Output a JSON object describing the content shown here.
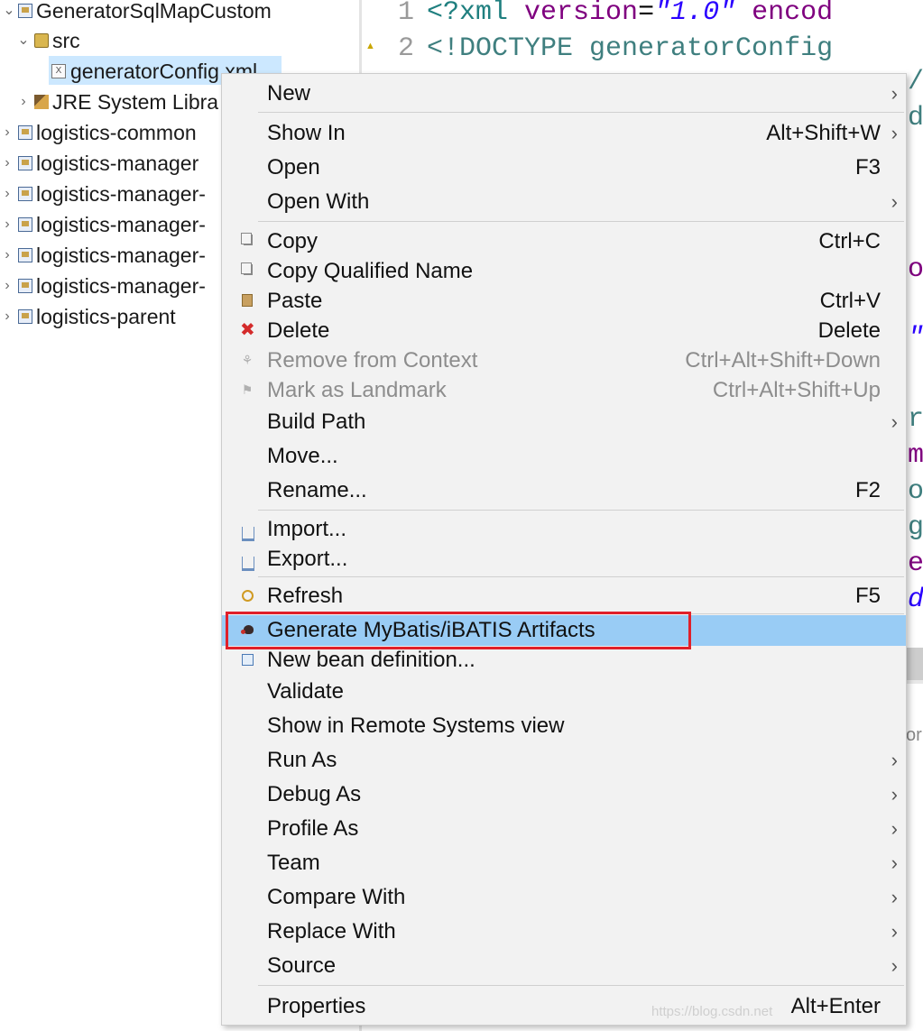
{
  "tree": {
    "items": [
      {
        "label": "GeneratorSqlMapCustom",
        "icon": "project-icon",
        "twisty": "expanded"
      },
      {
        "label": "src",
        "icon": "package-folder-icon",
        "twisty": "expanded"
      },
      {
        "label": "generatorConfig.xml",
        "icon": "xml-file-icon",
        "twisty": ""
      },
      {
        "label": "JRE System Libra",
        "icon": "library-icon",
        "twisty": "collapsed"
      },
      {
        "label": "logistics-common",
        "icon": "maven-project-icon",
        "twisty": "collapsed"
      },
      {
        "label": "logistics-manager",
        "icon": "maven-project-icon",
        "twisty": "collapsed"
      },
      {
        "label": "logistics-manager-",
        "icon": "maven-project-icon",
        "twisty": "collapsed"
      },
      {
        "label": "logistics-manager-",
        "icon": "maven-project-icon",
        "twisty": "collapsed"
      },
      {
        "label": "logistics-manager-",
        "icon": "maven-project-icon",
        "twisty": "collapsed"
      },
      {
        "label": "logistics-manager-",
        "icon": "maven-project-icon",
        "twisty": "collapsed"
      },
      {
        "label": "logistics-parent",
        "icon": "maven-project-icon",
        "twisty": "collapsed"
      }
    ],
    "twisty_expanded": "⌄",
    "twisty_collapsed": "›"
  },
  "editor": {
    "lines": [
      {
        "num": "1",
        "open": "<?xml ",
        "attr": "version",
        "eq": "=",
        "val": "\"1.0\"",
        "rest": " encod"
      },
      {
        "num": "2",
        "text": "<!DOCTYPE generatorConfig"
      }
    ],
    "fragments": [
      "/",
      "d",
      "o",
      "\"",
      "r",
      "m",
      "o",
      "g",
      "e",
      "d",
      "or"
    ]
  },
  "context_menu": {
    "items": [
      {
        "label": "New",
        "shortcut": "",
        "submenu": true,
        "icon": "",
        "disabled": false
      },
      {
        "label": "Show In",
        "shortcut": "Alt+Shift+W",
        "submenu": true,
        "icon": "",
        "disabled": false
      },
      {
        "label": "Open",
        "shortcut": "F3",
        "submenu": false,
        "icon": "",
        "disabled": false
      },
      {
        "label": "Open With",
        "shortcut": "",
        "submenu": true,
        "icon": "",
        "disabled": false
      },
      {
        "label": "Copy",
        "shortcut": "Ctrl+C",
        "submenu": false,
        "icon": "copy-icon",
        "disabled": false
      },
      {
        "label": "Copy Qualified Name",
        "shortcut": "",
        "submenu": false,
        "icon": "copy-qualified-name-icon",
        "disabled": false
      },
      {
        "label": "Paste",
        "shortcut": "Ctrl+V",
        "submenu": false,
        "icon": "paste-icon",
        "disabled": false
      },
      {
        "label": "Delete",
        "shortcut": "Delete",
        "submenu": false,
        "icon": "delete-icon",
        "disabled": false
      },
      {
        "label": "Remove from Context",
        "shortcut": "Ctrl+Alt+Shift+Down",
        "submenu": false,
        "icon": "remove-context-icon",
        "disabled": true
      },
      {
        "label": "Mark as Landmark",
        "shortcut": "Ctrl+Alt+Shift+Up",
        "submenu": false,
        "icon": "landmark-icon",
        "disabled": true
      },
      {
        "label": "Build Path",
        "shortcut": "",
        "submenu": true,
        "icon": "",
        "disabled": false
      },
      {
        "label": "Move...",
        "shortcut": "",
        "submenu": false,
        "icon": "",
        "disabled": false
      },
      {
        "label": "Rename...",
        "shortcut": "F2",
        "submenu": false,
        "icon": "",
        "disabled": false
      },
      {
        "label": "Import...",
        "shortcut": "",
        "submenu": false,
        "icon": "import-icon",
        "disabled": false
      },
      {
        "label": "Export...",
        "shortcut": "",
        "submenu": false,
        "icon": "export-icon",
        "disabled": false
      },
      {
        "label": "Refresh",
        "shortcut": "F5",
        "submenu": false,
        "icon": "refresh-icon",
        "disabled": false
      },
      {
        "label": "Generate MyBatis/iBATIS Artifacts",
        "shortcut": "",
        "submenu": false,
        "icon": "mybatis-bird-icon",
        "disabled": false,
        "highlighted": true
      },
      {
        "label": "New bean definition...",
        "shortcut": "",
        "submenu": false,
        "icon": "bean-icon",
        "disabled": false
      },
      {
        "label": "Validate",
        "shortcut": "",
        "submenu": false,
        "icon": "",
        "disabled": false
      },
      {
        "label": "Show in Remote Systems view",
        "shortcut": "",
        "submenu": false,
        "icon": "",
        "disabled": false
      },
      {
        "label": "Run As",
        "shortcut": "",
        "submenu": true,
        "icon": "",
        "disabled": false
      },
      {
        "label": "Debug As",
        "shortcut": "",
        "submenu": true,
        "icon": "",
        "disabled": false
      },
      {
        "label": "Profile As",
        "shortcut": "",
        "submenu": true,
        "icon": "",
        "disabled": false
      },
      {
        "label": "Team",
        "shortcut": "",
        "submenu": true,
        "icon": "",
        "disabled": false
      },
      {
        "label": "Compare With",
        "shortcut": "",
        "submenu": true,
        "icon": "",
        "disabled": false
      },
      {
        "label": "Replace With",
        "shortcut": "",
        "submenu": true,
        "icon": "",
        "disabled": false
      },
      {
        "label": "Source",
        "shortcut": "",
        "submenu": true,
        "icon": "",
        "disabled": false
      },
      {
        "label": "Properties",
        "shortcut": "Alt+Enter",
        "submenu": false,
        "icon": "",
        "disabled": false
      }
    ],
    "submenu_arrow": "›"
  },
  "watermark": "https://blog.csdn.net",
  "colors": {
    "menu_bg": "#f2f2f2",
    "menu_highlight": "#99ccf5",
    "highlight_box": "#e0202a",
    "tree_selection": "#cce8ff",
    "disabled_text": "#8d8d8d"
  }
}
